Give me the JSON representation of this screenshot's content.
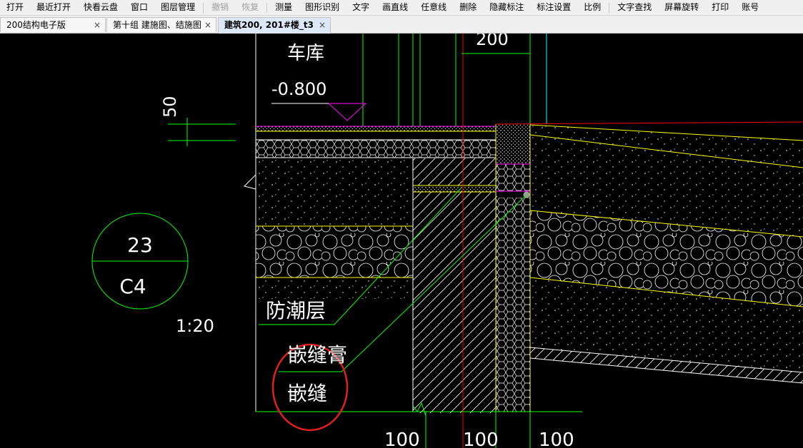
{
  "menu": {
    "items": [
      {
        "label": "打开",
        "disabled": false
      },
      {
        "label": "最近打开",
        "disabled": false
      },
      {
        "label": "快看云盘",
        "disabled": false
      },
      {
        "label": "窗口",
        "disabled": false
      },
      {
        "label": "图层管理",
        "disabled": false
      },
      {
        "label": "撤销",
        "disabled": true
      },
      {
        "label": "恢复",
        "disabled": true
      },
      {
        "label": "测量",
        "disabled": false
      },
      {
        "label": "图形识别",
        "disabled": false
      },
      {
        "label": "文字",
        "disabled": false
      },
      {
        "label": "画直线",
        "disabled": false
      },
      {
        "label": "任意线",
        "disabled": false
      },
      {
        "label": "删除",
        "disabled": false
      },
      {
        "label": "隐藏标注",
        "disabled": false
      },
      {
        "label": "标注设置",
        "disabled": false
      },
      {
        "label": "比例",
        "disabled": false
      },
      {
        "label": "文字查找",
        "disabled": false
      },
      {
        "label": "屏幕旋转",
        "disabled": false
      },
      {
        "label": "打印",
        "disabled": false
      },
      {
        "label": "账号",
        "disabled": false
      }
    ]
  },
  "tabs": [
    {
      "label": "200结构电子版",
      "active": false
    },
    {
      "label": "第十组 建施图、结施图",
      "active": false
    },
    {
      "label": "建筑200, 201#楼_t3",
      "active": true
    }
  ],
  "tab_close_glyph": "×",
  "drawing": {
    "room_label": "车库",
    "elevation": "-0.800",
    "dim_50": "50",
    "dim_200": "200",
    "callout_top": "23",
    "callout_bottom": "C4",
    "scale": "1:20",
    "label_damp_proof": "防潮层",
    "label_sealant": "嵌缝膏",
    "label_joint": "嵌缝",
    "dims_bottom": [
      "100",
      "100",
      "100"
    ]
  },
  "colors": {
    "line_white": "#ffffff",
    "line_yellow": "#ffff00",
    "line_green": "#00ff00",
    "line_magenta": "#ff00ff",
    "line_red": "#ff0000",
    "line_cyan": "#00ffff",
    "highlight_circle": "#e0201c"
  }
}
